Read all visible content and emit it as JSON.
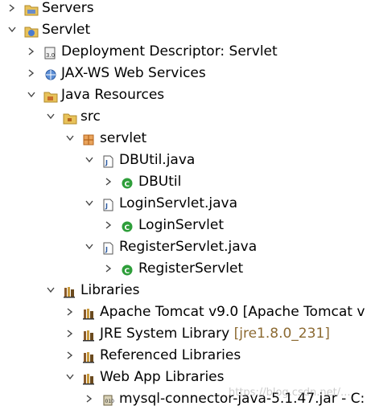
{
  "tree": {
    "servers": "Servers",
    "servlet": "Servlet",
    "deployment_descriptor": "Deployment Descriptor: Servlet",
    "jax_ws": "JAX-WS Web Services",
    "java_resources": "Java Resources",
    "src": "src",
    "package_servlet": "servlet",
    "dbutil_java": "DBUtil.java",
    "dbutil_class": "DBUtil",
    "loginservlet_java": "LoginServlet.java",
    "loginservlet_class": "LoginServlet",
    "registerservlet_java": "RegisterServlet.java",
    "registerservlet_class": "RegisterServlet",
    "libraries": "Libraries",
    "tomcat": "Apache Tomcat v9.0 [Apache Tomcat v",
    "jre": "JRE System Library",
    "jre_decoration": "[jre1.8.0_231]",
    "referenced": "Referenced Libraries",
    "webapp": "Web App Libraries",
    "mysql_jar": "mysql-connector-java-5.1.47.jar - C:"
  },
  "watermark": "https://blog.csdn.net/...",
  "icons": {
    "expanded": "chevron-down-icon",
    "collapsed": "chevron-right-icon",
    "class_color": "#2e9e3a",
    "package_color": "#b5651d"
  }
}
